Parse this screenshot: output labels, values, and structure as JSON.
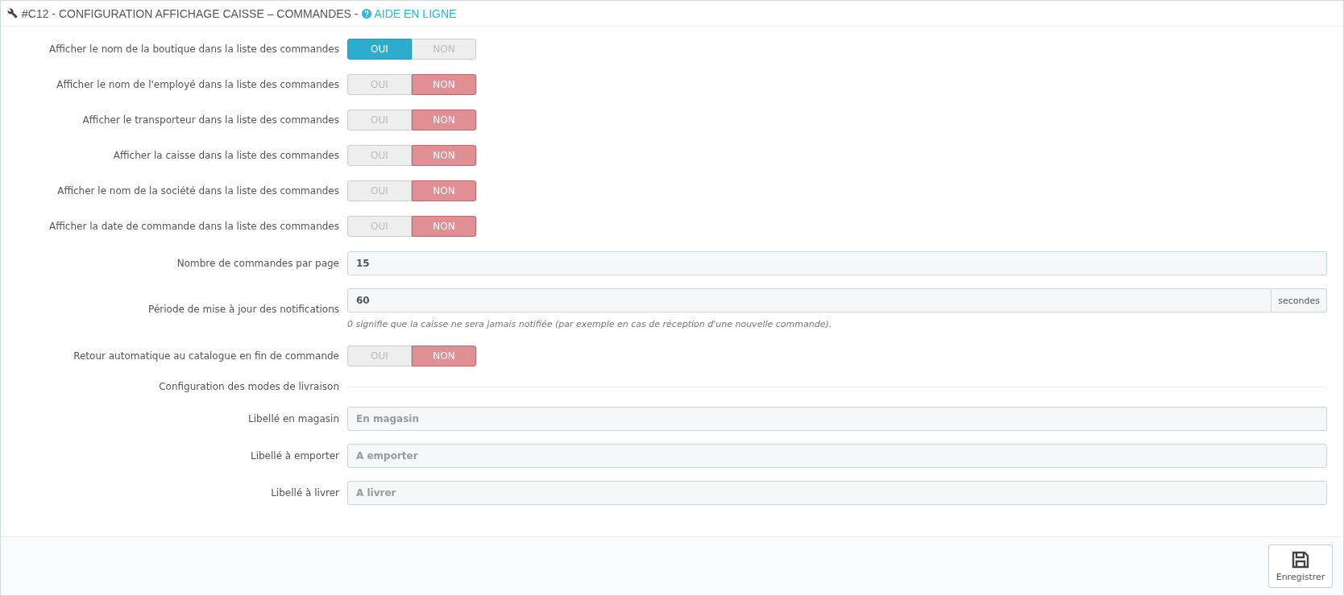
{
  "panel": {
    "title": "#C12 - CONFIGURATION AFFICHAGE CAISSE – COMMANDES -",
    "help_link": "AIDE EN LIGNE"
  },
  "rows": [
    {
      "kind": "toggle",
      "label": "Afficher le nom de la boutique dans la liste des commandes",
      "yes": "OUI",
      "no": "NON",
      "on": true
    },
    {
      "kind": "toggle",
      "label": "Afficher le nom de l'employé dans la liste des commandes",
      "yes": "OUI",
      "no": "NON",
      "on": false
    },
    {
      "kind": "toggle",
      "label": "Afficher le transporteur dans la liste des commandes",
      "yes": "OUI",
      "no": "NON",
      "on": false
    },
    {
      "kind": "toggle",
      "label": "Afficher la caisse dans la liste des commandes",
      "yes": "OUI",
      "no": "NON",
      "on": false
    },
    {
      "kind": "toggle",
      "label": "Afficher le nom de la société dans la liste des commandes",
      "yes": "OUI",
      "no": "NON",
      "on": false
    },
    {
      "kind": "toggle",
      "label": "Afficher la date de commande dans la liste des commandes",
      "yes": "OUI",
      "no": "NON",
      "on": false
    },
    {
      "kind": "text",
      "label": "Nombre de commandes par page",
      "value": "15"
    },
    {
      "kind": "text",
      "label": "Période de mise à jour des notifications",
      "value": "60",
      "suffix": "secondes",
      "help": "0 signifie que la caisse ne sera jamais notifiée (par exemple en cas de réception d'une nouvelle commande)."
    },
    {
      "kind": "toggle",
      "label": "Retour automatique au catalogue en fin de commande",
      "yes": "OUI",
      "no": "NON",
      "on": false
    },
    {
      "kind": "separator",
      "label": "Configuration des modes de livraison"
    },
    {
      "kind": "text",
      "label": "Libellé en magasin",
      "placeholder": "En magasin"
    },
    {
      "kind": "text",
      "label": "Libellé à emporter",
      "placeholder": "A emporter"
    },
    {
      "kind": "text",
      "label": "Libellé à livrer",
      "placeholder": "A livrer"
    }
  ],
  "footer": {
    "save_button": "Enregistrer"
  }
}
